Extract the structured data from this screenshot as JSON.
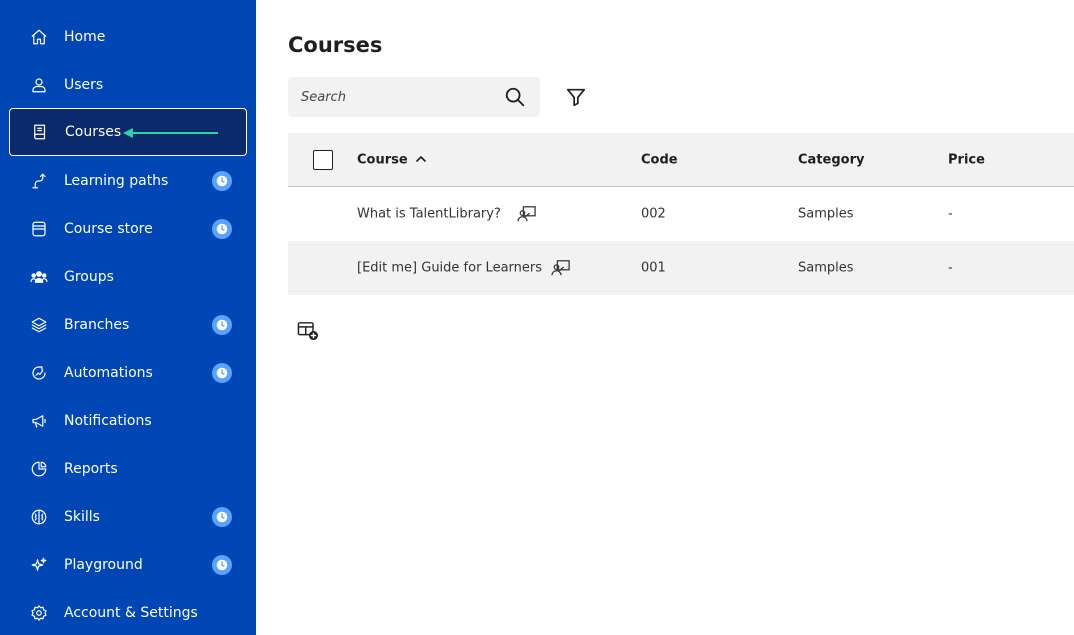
{
  "sidebar": {
    "items": [
      {
        "label": "Home",
        "icon": "home-icon",
        "badge": false,
        "active": false
      },
      {
        "label": "Users",
        "icon": "user-icon",
        "badge": false,
        "active": false
      },
      {
        "label": "Courses",
        "icon": "book-icon",
        "badge": false,
        "active": true
      },
      {
        "label": "Learning paths",
        "icon": "path-icon",
        "badge": true,
        "active": false
      },
      {
        "label": "Course store",
        "icon": "store-icon",
        "badge": true,
        "active": false
      },
      {
        "label": "Groups",
        "icon": "group-icon",
        "badge": false,
        "active": false
      },
      {
        "label": "Branches",
        "icon": "layers-icon",
        "badge": true,
        "active": false
      },
      {
        "label": "Automations",
        "icon": "automation-icon",
        "badge": true,
        "active": false
      },
      {
        "label": "Notifications",
        "icon": "megaphone-icon",
        "badge": false,
        "active": false
      },
      {
        "label": "Reports",
        "icon": "pie-chart-icon",
        "badge": false,
        "active": false
      },
      {
        "label": "Skills",
        "icon": "brain-icon",
        "badge": true,
        "active": false
      },
      {
        "label": "Playground",
        "icon": "sparkle-icon",
        "badge": true,
        "active": false
      },
      {
        "label": "Account & Settings",
        "icon": "gear-icon",
        "badge": false,
        "active": false
      }
    ]
  },
  "main": {
    "title": "Courses",
    "search": {
      "placeholder": "Search",
      "value": ""
    },
    "table": {
      "columns": [
        "Course",
        "Code",
        "Category",
        "Price"
      ],
      "sort": {
        "column": "Course",
        "direction": "ascending"
      },
      "rows": [
        {
          "course": "What is TalentLibrary?",
          "code": "002",
          "category": "Samples",
          "price": "-"
        },
        {
          "course": "[Edit me] Guide for Learners",
          "code": "001",
          "category": "Samples",
          "price": "-"
        }
      ]
    }
  },
  "colors": {
    "sidebar_bg": "#0046b5",
    "active_bg": "#0b2a6b",
    "badge": "#5aa3ff",
    "annotation_arrow": "#2bd4a4"
  }
}
